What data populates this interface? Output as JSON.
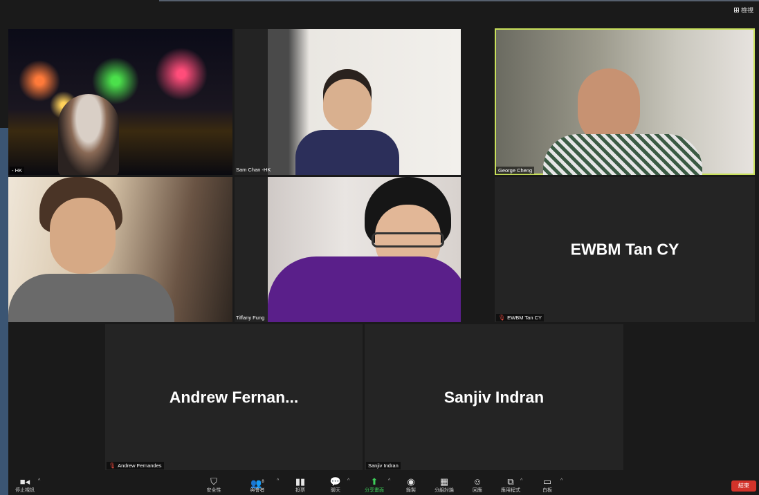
{
  "view": {
    "label": "檢視"
  },
  "participants": [
    {
      "name_tag": "- HK",
      "muted": false
    },
    {
      "name_tag": "Sam Chan -HK",
      "muted": false
    },
    {
      "name_tag": "George Cheng",
      "muted": false,
      "active_speaker": true
    },
    {
      "name_tag": "",
      "muted": false
    },
    {
      "name_tag": "Tiffany Fung",
      "muted": false
    },
    {
      "name_tag": "EWBM Tan CY",
      "display_name": "EWBM Tan CY",
      "muted": true
    },
    {
      "name_tag": "Andrew Fernandes",
      "display_name": "Andrew  Fernan...",
      "muted": true
    },
    {
      "name_tag": "Sanjiv Indran",
      "display_name": "Sanjiv Indran",
      "muted": false
    }
  ],
  "toolbar": {
    "stop_video": "停止視訊",
    "security": "安全性",
    "participants": "與會者",
    "participants_count": "8",
    "polls": "投票",
    "chat": "聊天",
    "share_screen": "分享畫面",
    "record": "錄製",
    "breakout": "分組討論",
    "reactions": "回應",
    "apps": "應用程式",
    "whiteboard": "白板",
    "end": "結束"
  },
  "colors": {
    "active_speaker": "#c8e05a",
    "share": "#3ecf5a",
    "end": "#d3332a",
    "muted": "#e5473c"
  }
}
